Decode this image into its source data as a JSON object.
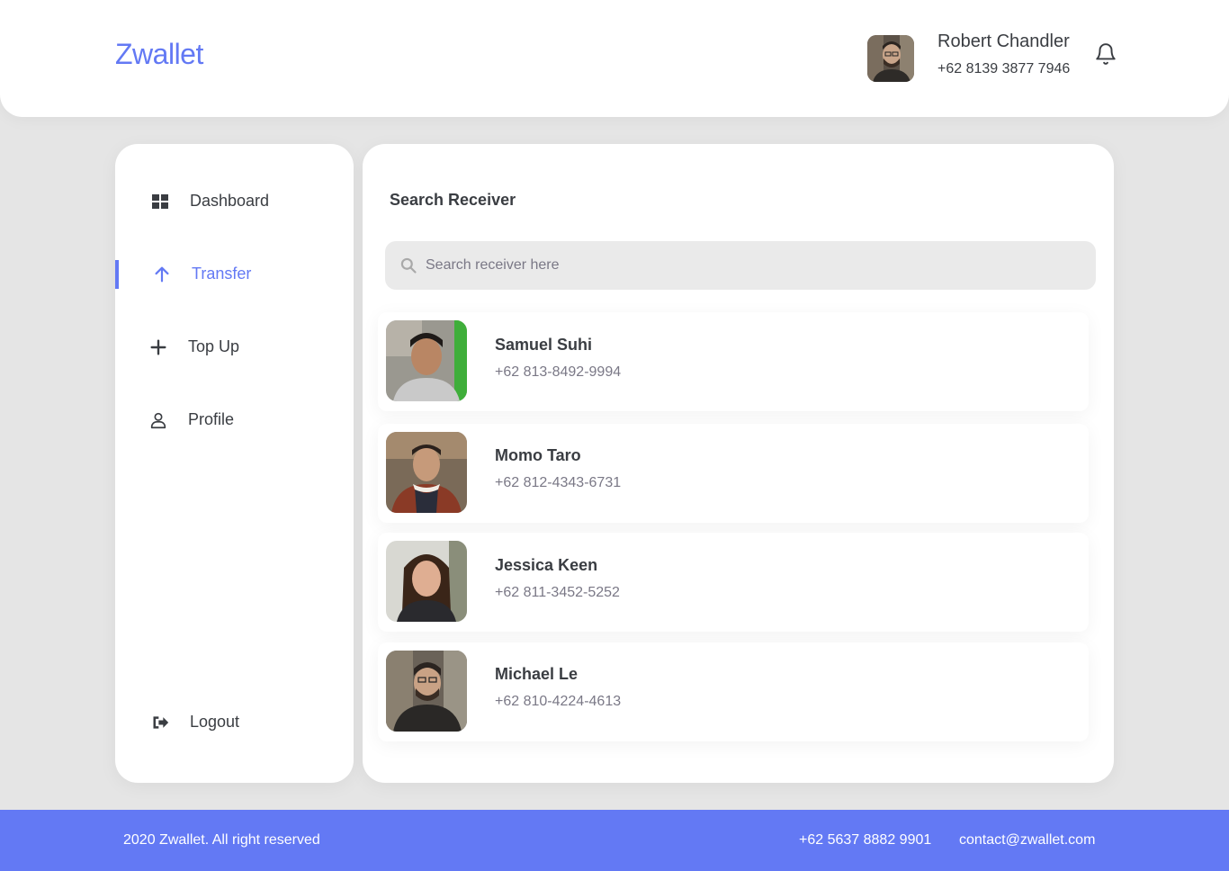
{
  "header": {
    "brand": "Zwallet",
    "user_name": "Robert Chandler",
    "user_phone": "+62 8139 3877 7946",
    "avatar_icon": "user-avatar-photo",
    "notification_icon": "bell-icon"
  },
  "sidebar": {
    "items": [
      {
        "label": "Dashboard",
        "icon": "grid-icon",
        "active": false
      },
      {
        "label": "Transfer",
        "icon": "arrow-up-icon",
        "active": true
      },
      {
        "label": "Top Up",
        "icon": "plus-icon",
        "active": false
      },
      {
        "label": "Profile",
        "icon": "user-icon",
        "active": false
      }
    ],
    "logout": {
      "label": "Logout",
      "icon": "logout-icon"
    }
  },
  "main": {
    "title": "Search Receiver",
    "search": {
      "placeholder": "Search receiver here",
      "value": ""
    },
    "receivers": [
      {
        "name": "Samuel Suhi",
        "phone": "+62 813-8492-9994"
      },
      {
        "name": "Momo Taro",
        "phone": "+62 812-4343-6731"
      },
      {
        "name": "Jessica Keen",
        "phone": "+62 811-3452-5252"
      },
      {
        "name": "Michael Le",
        "phone": "+62 810-4224-4613"
      }
    ]
  },
  "footer": {
    "copyright": "2020 Zwallet. All right reserved",
    "phone": "+62 5637 8882 9901",
    "email": "contact@zwallet.com"
  },
  "colors": {
    "accent": "#6379f4",
    "background": "#e5e5e5",
    "text": "#3a3d42",
    "muted": "#7a7886"
  }
}
